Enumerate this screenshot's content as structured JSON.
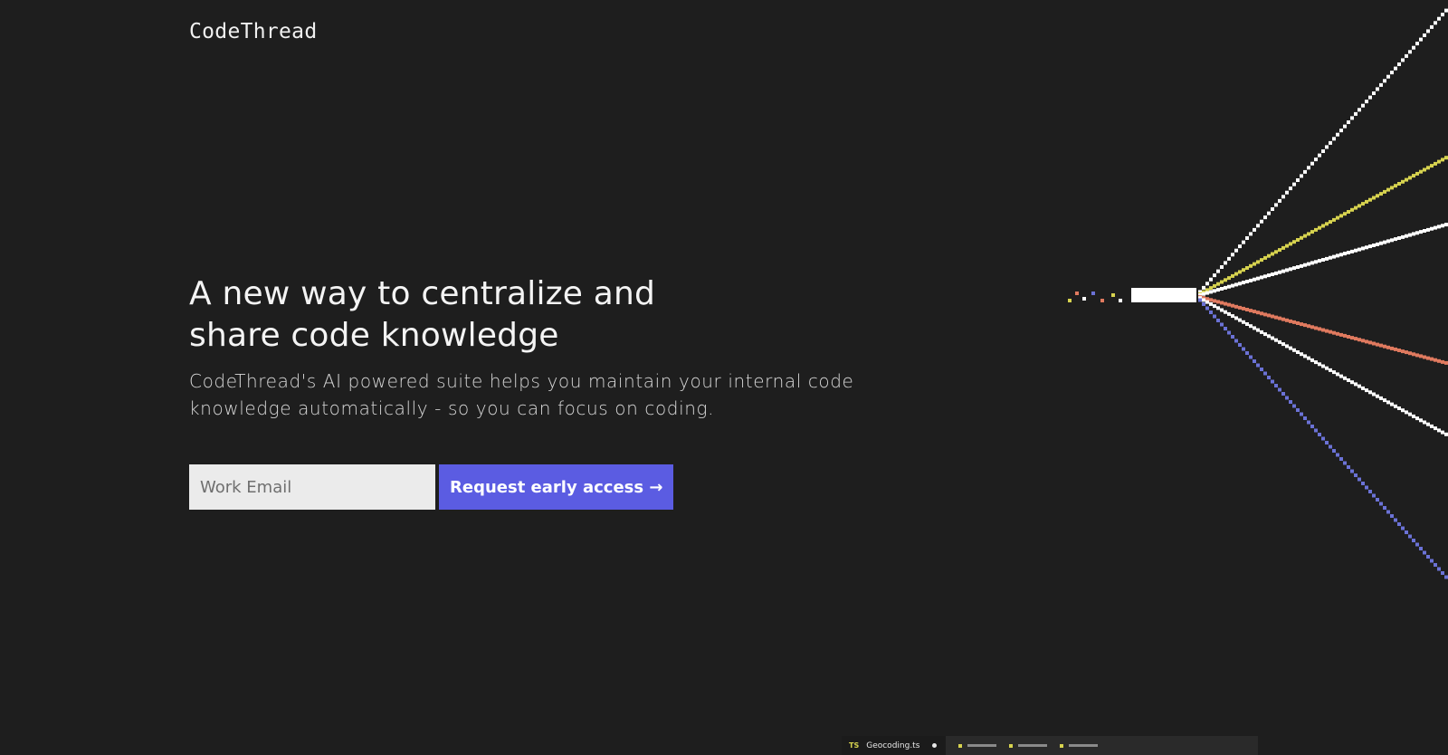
{
  "brand": {
    "logo_text": "CodeThread"
  },
  "hero": {
    "headline_line1": "A new way to centralize and",
    "headline_line2": "share code knowledge",
    "subheadline_line1": "CodeThread's AI powered suite helps you maintain your internal code",
    "subheadline_line2": "knowledge automatically - so you can focus on coding."
  },
  "signup": {
    "email_placeholder": "Work Email",
    "email_value": "",
    "cta_label": "Request early access →"
  },
  "editor_preview": {
    "file_type_badge": "TS",
    "file_name": "Geocoding.ts"
  },
  "colors": {
    "background": "#1e1e1e",
    "accent": "#5b5ce2",
    "thread_white": "#ffffff",
    "thread_yellow": "#d7d34f",
    "thread_salmon": "#e07a5f",
    "thread_blue": "#6b72d6"
  },
  "icons": {
    "decor": "pixel-thread-fan"
  }
}
